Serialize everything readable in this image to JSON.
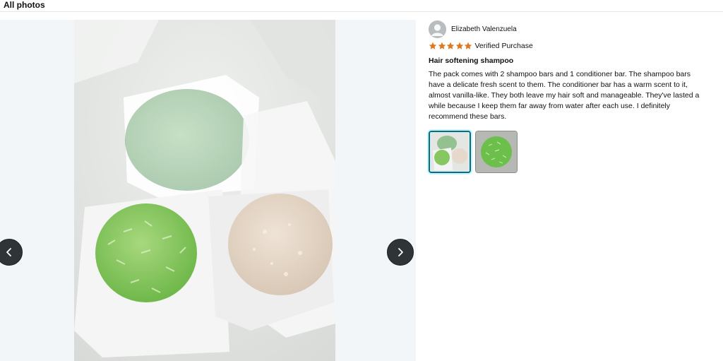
{
  "header": {
    "title": "All photos"
  },
  "viewer": {
    "prev_icon": "chevron-left-icon",
    "next_icon": "chevron-right-icon",
    "photo_alt": "Two shampoo bars and one conditioner bar on wrapping paper"
  },
  "review": {
    "reviewer_name": "Elizabeth Valenzuela",
    "rating": 5,
    "rating_max": 5,
    "star_color": "#de7921",
    "verified_label": "Verified Purchase",
    "title": "Hair softening shampoo",
    "body": "The pack comes with 2 shampoo bars and 1 conditioner bar. The shampoo bars have a delicate fresh scent to them. The conditioner bar has a warm scent to it, almost vanilla-like. They both leave my hair soft and manageable. They've lasted a while because I keep them far away from water after each use. I definitely recommend these bars."
  },
  "thumbnails": [
    {
      "id": "thumb-1",
      "selected": true
    },
    {
      "id": "thumb-2",
      "selected": false
    }
  ]
}
